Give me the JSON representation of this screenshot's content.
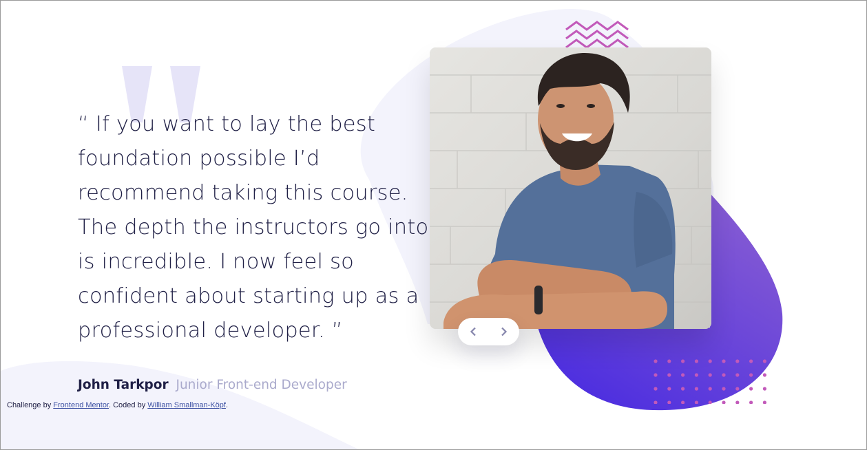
{
  "testimonial": {
    "quote": "“ If you want to lay the best\nfoundation possible I’d\nrecommend taking this course.\nThe depth the instructors go into\nis incredible. I now feel so\nconfident about starting up as a\nprofessional developer. ”",
    "author_name": "John Tarkpor",
    "author_role": "Junior Front-end Developer",
    "photo_alt": "John Tarkpor"
  },
  "navigation": {
    "prev_label": "Previous",
    "next_label": "Next"
  },
  "attribution": {
    "prefix": "Challenge by ",
    "challenge_link": "Frontend Mentor",
    "middle": ". Coded by ",
    "author_link": "William Smallman-Köpf",
    "suffix": "."
  },
  "colors": {
    "dark_blue": "#202046",
    "grayish_blue": "#aaaacc",
    "light_bg": "#f3f3fc",
    "blob_purple_light": "#8a5fd2",
    "blob_blue_dark": "#4b2de0",
    "pattern_pink": "#c25aba",
    "quote_mark": "#e6e4f8"
  },
  "icons": {
    "prev": "chevron-left-icon",
    "next": "chevron-right-icon",
    "quote": "quotation-mark-icon"
  }
}
